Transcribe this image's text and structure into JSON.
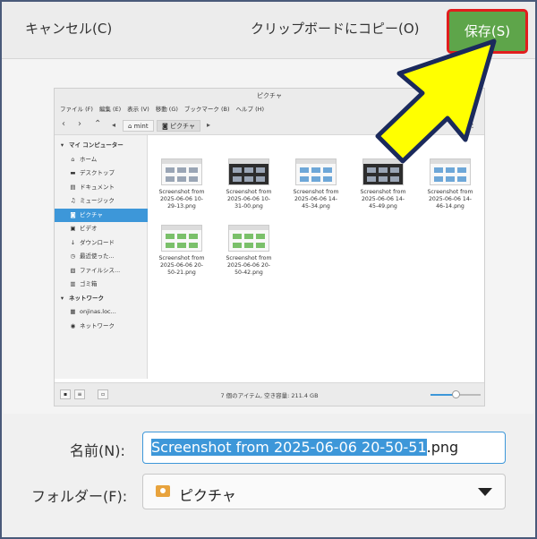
{
  "header": {
    "cancel_label": "キャンセル(C)",
    "copy_label": "クリップボードにコピー(O)",
    "save_label": "保存(S)"
  },
  "preview": {
    "window_title": "ピクチャ",
    "menu": [
      "ファイル (F)",
      "編集 (E)",
      "表示 (V)",
      "移動 (G)",
      "ブックマーク (B)",
      "ヘルプ (H)"
    ],
    "path": [
      "mint",
      "ピクチャ"
    ],
    "sidebar": [
      {
        "label": "マイ コンピューター",
        "head": true,
        "icon": "chevron-down-icon"
      },
      {
        "label": "ホーム",
        "icon": "home-icon"
      },
      {
        "label": "デスクトップ",
        "icon": "desktop-icon"
      },
      {
        "label": "ドキュメント",
        "icon": "document-icon"
      },
      {
        "label": "ミュージック",
        "icon": "music-icon"
      },
      {
        "label": "ピクチャ",
        "icon": "camera-icon",
        "selected": true
      },
      {
        "label": "ビデオ",
        "icon": "video-icon"
      },
      {
        "label": "ダウンロード",
        "icon": "download-icon"
      },
      {
        "label": "最近使った...",
        "icon": "clock-icon"
      },
      {
        "label": "ファイルシス...",
        "icon": "drive-icon"
      },
      {
        "label": "ゴミ箱",
        "icon": "trash-icon"
      },
      {
        "label": "ネットワーク",
        "head": true,
        "icon": "chevron-down-icon"
      },
      {
        "label": "onjinas.loc...",
        "icon": "server-icon"
      },
      {
        "label": "ネットワーク",
        "icon": "network-icon"
      }
    ],
    "files": [
      {
        "name": "Screenshot from 2025-06-06 10-29-13.png",
        "line1": "Screenshot from",
        "line2": "2025-06-06 10-",
        "line3": "29-13.png",
        "style": "plain"
      },
      {
        "name": "Screenshot from 2025-06-06 10-31-00.png",
        "line1": "Screenshot from",
        "line2": "2025-06-06 10-",
        "line3": "31-00.png",
        "style": "dark"
      },
      {
        "name": "Screenshot from 2025-06-06 14-45-34.png",
        "line1": "Screenshot from",
        "line2": "2025-06-06 14-",
        "line3": "45-34.png",
        "style": "blue"
      },
      {
        "name": "Screenshot from 2025-06-06 14-45-49.png",
        "line1": "Screenshot from",
        "line2": "2025-06-06 14-",
        "line3": "45-49.png",
        "style": "dark"
      },
      {
        "name": "Screenshot from 2025-06-06 14-46-14.png",
        "line1": "Screenshot from",
        "line2": "2025-06-06 14-",
        "line3": "46-14.png",
        "style": "blue"
      },
      {
        "name": "Screenshot from 2025-06-06 20-50-21.png",
        "line1": "Screenshot from",
        "line2": "2025-06-06 20-",
        "line3": "50-21.png",
        "style": "green"
      },
      {
        "name": "Screenshot from 2025-06-06 20-50-42.png",
        "line1": "Screenshot from",
        "line2": "2025-06-06 20-",
        "line3": "50-42.png",
        "style": "green"
      }
    ],
    "status": "7 個のアイテム, 空き容量: 211.4 GB",
    "zoom_fraction": 0.5
  },
  "form": {
    "name_label": "名前(N):",
    "name_selected": "Screenshot from 2025-06-06 20-50-51",
    "name_ext": ".png",
    "folder_label": "フォルダー(F):",
    "folder_value": "ピクチャ"
  },
  "colors": {
    "save_bg": "#5ea54a",
    "save_border": "#e11d1d",
    "arrow_fill": "#ffff00",
    "selection": "#3d97d9"
  }
}
